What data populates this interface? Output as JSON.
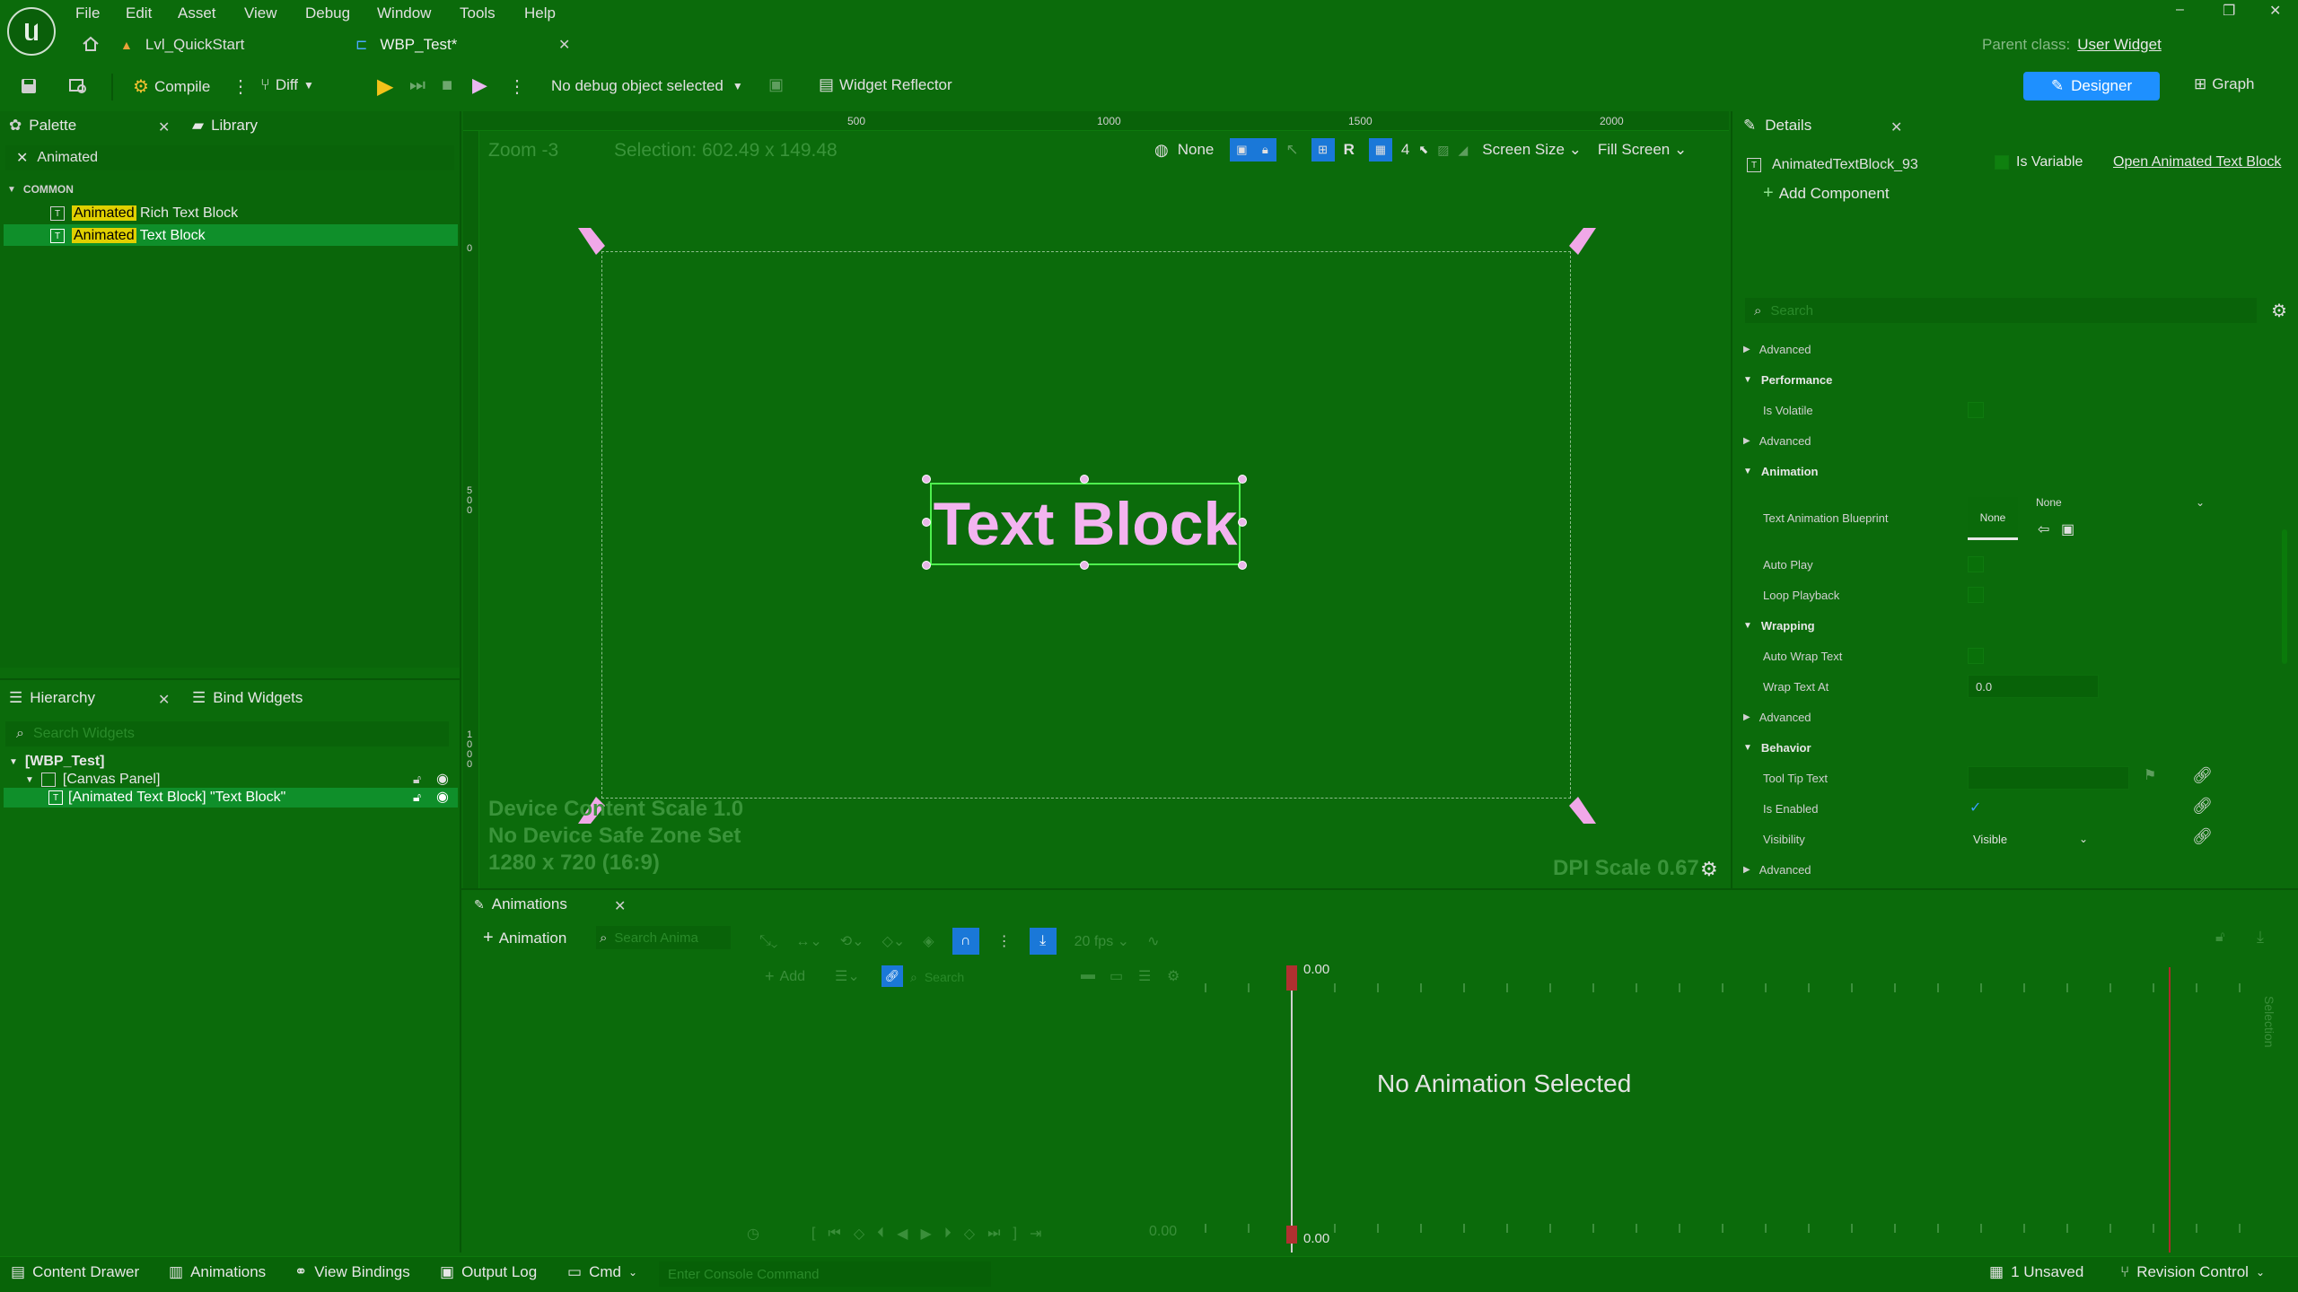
{
  "menu": [
    "File",
    "Edit",
    "Asset",
    "View",
    "Debug",
    "Window",
    "Tools",
    "Help"
  ],
  "tabs": [
    {
      "label": "Lvl_QuickStart"
    },
    {
      "label": "WBP_Test*"
    }
  ],
  "window_controls": {
    "minimize": "–",
    "restore": "❐",
    "close": "✕"
  },
  "parent_class": {
    "label": "Parent class:",
    "value": "User Widget"
  },
  "toolbar": {
    "compile": "Compile",
    "diff": "Diff",
    "debug_object": "No debug object selected",
    "widget_reflector": "Widget Reflector",
    "designer": "Designer",
    "graph": "Graph"
  },
  "palette": {
    "tab_label": "Palette",
    "library_label": "Library",
    "search_value": "Animated",
    "category": "COMMON",
    "items": [
      {
        "highlight": "Animated",
        "rest": " Rich Text Block"
      },
      {
        "highlight": "Animated",
        "rest": " Text Block"
      }
    ]
  },
  "hierarchy": {
    "tab_label": "Hierarchy",
    "bind_label": "Bind Widgets",
    "search_placeholder": "Search Widgets",
    "items": [
      {
        "label": "[WBP_Test]"
      },
      {
        "label": "[Canvas Panel]"
      },
      {
        "label": "[Animated Text Block] \"Text Block\""
      }
    ]
  },
  "designer": {
    "zoom": "Zoom -3",
    "selection": "Selection: 602.49 x 149.48",
    "ruler_ticks": [
      "500",
      "1000",
      "1500",
      "2000"
    ],
    "vertical_ticks": [
      "0",
      "5\n0\n0",
      "1\n0\n0\n0"
    ],
    "toolbar": {
      "none": "None",
      "r": "R",
      "grid": "4",
      "screen_size": "Screen Size",
      "fill_screen": "Fill Screen"
    },
    "text_block": "Text Block",
    "device_content_scale": "Device Content Scale 1.0",
    "safe_zone": "No Device Safe Zone Set",
    "resolution": "1280 x 720 (16:9)",
    "dpi_scale": "DPI Scale 0.67"
  },
  "details": {
    "tab_label": "Details",
    "widget_name": "AnimatedTextBlock_93",
    "is_variable": "Is Variable",
    "open_animated": "Open Animated Text Block",
    "add_component": "Add Component",
    "search_placeholder": "Search",
    "rows": {
      "advanced1": "Advanced",
      "performance": "Performance",
      "is_volatile": "Is Volatile",
      "advanced2": "Advanced",
      "animation": "Animation",
      "text_anim_bp": "Text Animation Blueprint",
      "none_thumb": "None",
      "none_dropdown": "None",
      "auto_play": "Auto Play",
      "loop_playback": "Loop Playback",
      "wrapping": "Wrapping",
      "auto_wrap": "Auto Wrap Text",
      "wrap_at": "Wrap Text At",
      "wrap_at_value": "0.0",
      "advanced3": "Advanced",
      "behavior": "Behavior",
      "tooltip": "Tool Tip Text",
      "is_enabled": "Is Enabled",
      "visibility": "Visibility",
      "visibility_value": "Visible",
      "advanced4": "Advanced"
    }
  },
  "animations": {
    "tab_label": "Animations",
    "add_animation": "Animation",
    "search_placeholder": "Search Anima",
    "add_track": "Add",
    "track_search_placeholder": "Search",
    "fps": "20 fps",
    "time_top": "0.00",
    "time_bottom": "0.00",
    "time_field": "0.00",
    "empty_message": "No Animation Selected",
    "selection_label": "Selection"
  },
  "statusbar": {
    "content_drawer": "Content Drawer",
    "animations": "Animations",
    "view_bindings": "View Bindings",
    "output_log": "Output Log",
    "cmd": "Cmd",
    "console_placeholder": "Enter Console Command",
    "unsaved": "1 Unsaved",
    "revision_control": "Revision Control"
  }
}
